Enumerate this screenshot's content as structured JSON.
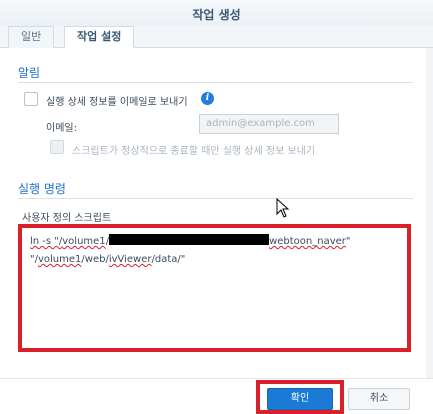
{
  "dialog": {
    "title": "작업 생성"
  },
  "tabs": [
    {
      "label": "일반"
    },
    {
      "label": "작업 설정"
    }
  ],
  "notification": {
    "section_title": "알림",
    "send_details_label": "실행 상세 정보를 이메일로 보내기",
    "email_label": "이메일:",
    "email_placeholder": "admin@example.com",
    "abnormal_only_label": "스크립트가 정상적으로 종료할 때만 실행 상세 정보 보내기"
  },
  "run_command": {
    "section_title": "실행 명령",
    "script_label": "사용자 정의 스크립트",
    "script_line1_prefix": "ln -s \"/",
    "script_line1_path": "volume1",
    "script_line1_after_path": "/",
    "script_line1_folder": "webtoon_naver",
    "script_line1_suffix": "\"",
    "script_line2_prefix": "\"/",
    "script_line2_vol": "volume1",
    "script_line2_mid": "/web/",
    "script_line2_viewer": "ivViewer",
    "script_line2_suffix": "/data/\""
  },
  "footer": {
    "ok_label": "확인",
    "cancel_label": "취소"
  },
  "colors": {
    "accent": "#1b7ad6",
    "highlight": "#d9212c"
  }
}
